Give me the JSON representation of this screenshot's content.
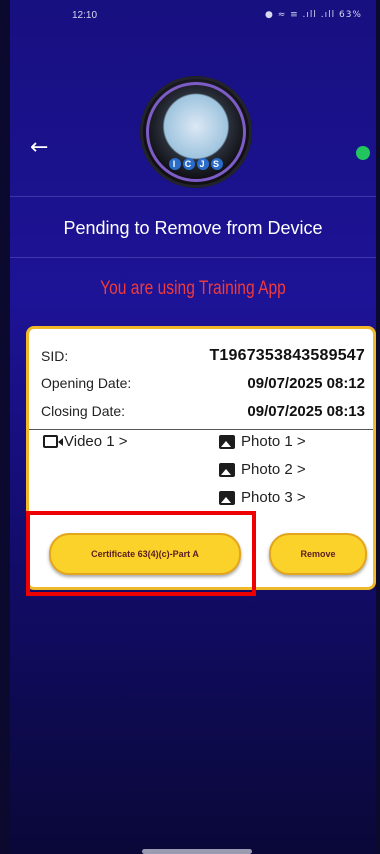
{
  "status_bar": {
    "time": "12:10",
    "icons": "● ≈ ≡ .ıll .ıll",
    "battery": "63%"
  },
  "header": {
    "logo_text": [
      "I",
      "C",
      "J",
      "S"
    ],
    "status_dot_color": "#22c55e"
  },
  "page": {
    "title": "Pending to Remove from Device",
    "training_notice": "You are using Training App"
  },
  "card": {
    "sid_label": "SID:",
    "sid_value": "T1967353843589547",
    "opening_label": "Opening Date:",
    "opening_value": "09/07/2025 08:12",
    "closing_label": "Closing Date:",
    "closing_value": "09/07/2025 08:13",
    "videos": [
      "Video 1 >"
    ],
    "photos": [
      "Photo 1 >",
      "Photo 2 >",
      "Photo 3 >"
    ],
    "certificate_button": "Certificate 63(4)(c)-Part A",
    "remove_button": "Remove"
  },
  "colors": {
    "accent_yellow": "#fbd22a",
    "card_border": "#f0b92a",
    "training_red": "#ef3b3b",
    "highlight_red": "#ee0000"
  }
}
